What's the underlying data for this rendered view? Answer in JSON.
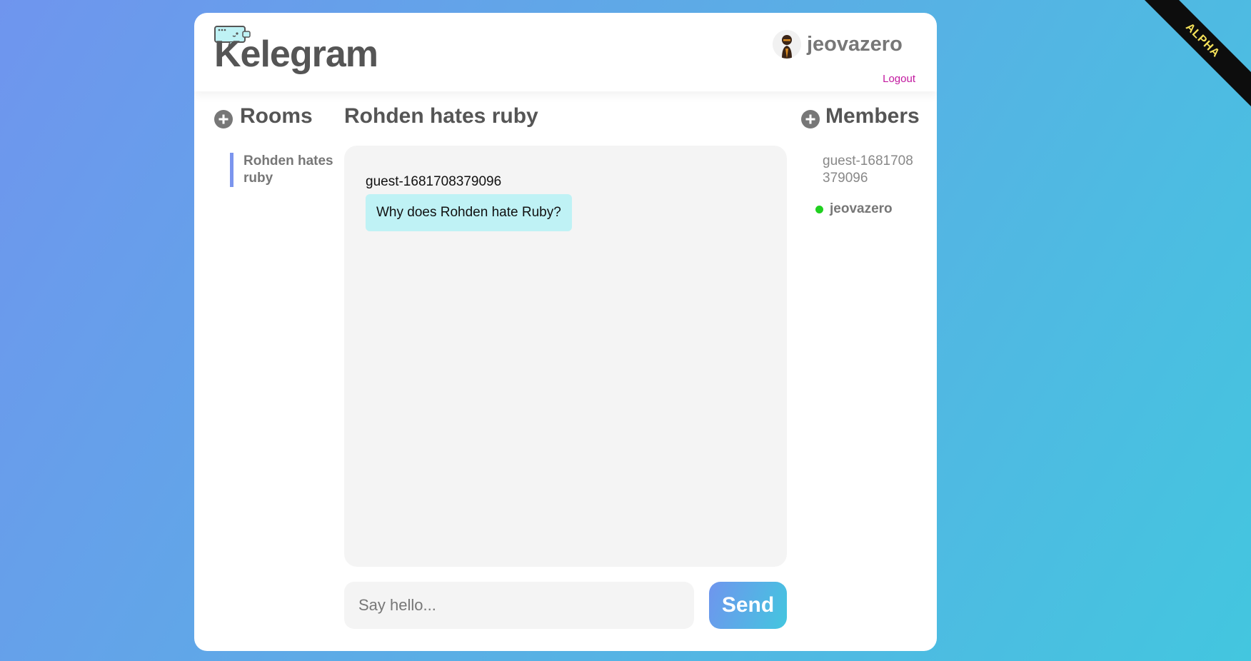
{
  "ribbon": {
    "label": "ALPHA"
  },
  "header": {
    "logo_text": "Kelegram",
    "username": "jeovazero",
    "logout_label": "Logout"
  },
  "rooms": {
    "title": "Rooms",
    "items": [
      {
        "label": "Rohden hates ruby",
        "active": true
      }
    ]
  },
  "chat": {
    "title": "Rohden hates ruby",
    "messages": [
      {
        "author": "guest-1681708379096",
        "text": "Why does Rohden hate Ruby?"
      }
    ],
    "input_placeholder": "Say hello...",
    "send_label": "Send"
  },
  "members": {
    "title": "Members",
    "items": [
      {
        "name": "guest-1681708379096",
        "online": false
      },
      {
        "name": "jeovazero",
        "online": true
      }
    ]
  },
  "colors": {
    "accent": "#7b95ee",
    "bubble": "#bff2f5",
    "online": "#20d020",
    "logout": "#c2189f",
    "ribbon_text": "#f6e25a"
  }
}
